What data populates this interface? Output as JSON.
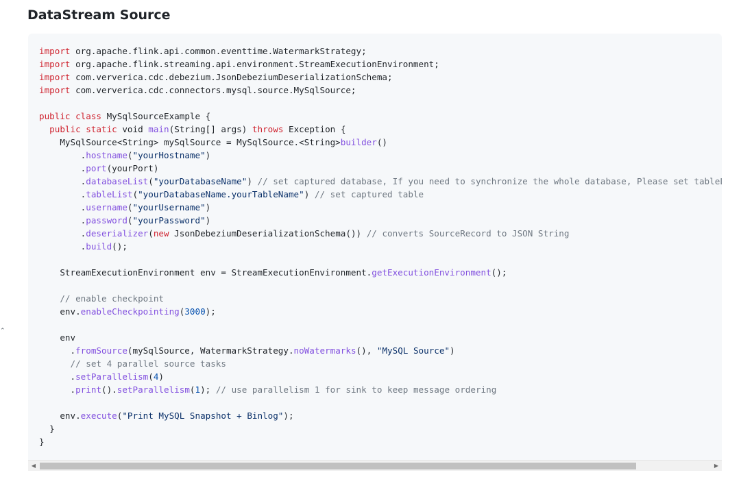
{
  "page": {
    "heading": "DataStream Source"
  },
  "code_block": {
    "language": "java",
    "colors": {
      "background": "#f6f8fa",
      "keyword": "#cf222e",
      "method": "#8250df",
      "string": "#0a3069",
      "number": "#0550ae",
      "comment": "#6e7781"
    },
    "lines": [
      [
        {
          "t": "import",
          "c": "kw"
        },
        {
          "t": " org.apache.flink.api.common.eventtime.WatermarkStrategy;"
        }
      ],
      [
        {
          "t": "import",
          "c": "kw"
        },
        {
          "t": " org.apache.flink.streaming.api.environment.StreamExecutionEnvironment;"
        }
      ],
      [
        {
          "t": "import",
          "c": "kw"
        },
        {
          "t": " com.ververica.cdc.debezium.JsonDebeziumDeserializationSchema;"
        }
      ],
      [
        {
          "t": "import",
          "c": "kw"
        },
        {
          "t": " com.ververica.cdc.connectors.mysql.source.MySqlSource;"
        }
      ],
      [],
      [
        {
          "t": "public",
          "c": "kw"
        },
        {
          "t": " "
        },
        {
          "t": "class",
          "c": "kw"
        },
        {
          "t": " MySqlSourceExample {"
        }
      ],
      [
        {
          "t": "  "
        },
        {
          "t": "public",
          "c": "kw"
        },
        {
          "t": " "
        },
        {
          "t": "static",
          "c": "kw"
        },
        {
          "t": " void "
        },
        {
          "t": "main",
          "c": "fn"
        },
        {
          "t": "(String[] args) "
        },
        {
          "t": "throws",
          "c": "kw"
        },
        {
          "t": " Exception {"
        }
      ],
      [
        {
          "t": "    MySqlSource<String> mySqlSource = MySqlSource.<String>"
        },
        {
          "t": "builder",
          "c": "fn"
        },
        {
          "t": "()"
        }
      ],
      [
        {
          "t": "        ."
        },
        {
          "t": "hostname",
          "c": "fn"
        },
        {
          "t": "("
        },
        {
          "t": "\"yourHostname\"",
          "c": "str"
        },
        {
          "t": ")"
        }
      ],
      [
        {
          "t": "        ."
        },
        {
          "t": "port",
          "c": "fn"
        },
        {
          "t": "(yourPort)"
        }
      ],
      [
        {
          "t": "        ."
        },
        {
          "t": "databaseList",
          "c": "fn"
        },
        {
          "t": "("
        },
        {
          "t": "\"yourDatabaseName\"",
          "c": "str"
        },
        {
          "t": ") "
        },
        {
          "t": "// set captured database, If you need to synchronize the whole database, Please set tableList",
          "c": "cm"
        }
      ],
      [
        {
          "t": "        ."
        },
        {
          "t": "tableList",
          "c": "fn"
        },
        {
          "t": "("
        },
        {
          "t": "\"yourDatabaseName.yourTableName\"",
          "c": "str"
        },
        {
          "t": ") "
        },
        {
          "t": "// set captured table",
          "c": "cm"
        }
      ],
      [
        {
          "t": "        ."
        },
        {
          "t": "username",
          "c": "fn"
        },
        {
          "t": "("
        },
        {
          "t": "\"yourUsername\"",
          "c": "str"
        },
        {
          "t": ")"
        }
      ],
      [
        {
          "t": "        ."
        },
        {
          "t": "password",
          "c": "fn"
        },
        {
          "t": "("
        },
        {
          "t": "\"yourPassword\"",
          "c": "str"
        },
        {
          "t": ")"
        }
      ],
      [
        {
          "t": "        ."
        },
        {
          "t": "deserializer",
          "c": "fn"
        },
        {
          "t": "("
        },
        {
          "t": "new",
          "c": "kw"
        },
        {
          "t": " JsonDebeziumDeserializationSchema()) "
        },
        {
          "t": "// converts SourceRecord to JSON String",
          "c": "cm"
        }
      ],
      [
        {
          "t": "        ."
        },
        {
          "t": "build",
          "c": "fn"
        },
        {
          "t": "();"
        }
      ],
      [],
      [
        {
          "t": "    StreamExecutionEnvironment env = StreamExecutionEnvironment."
        },
        {
          "t": "getExecutionEnvironment",
          "c": "fn"
        },
        {
          "t": "();"
        }
      ],
      [],
      [
        {
          "t": "    "
        },
        {
          "t": "// enable checkpoint",
          "c": "cm"
        }
      ],
      [
        {
          "t": "    env."
        },
        {
          "t": "enableCheckpointing",
          "c": "fn"
        },
        {
          "t": "("
        },
        {
          "t": "3000",
          "c": "num"
        },
        {
          "t": ");"
        }
      ],
      [],
      [
        {
          "t": "    env"
        }
      ],
      [
        {
          "t": "      ."
        },
        {
          "t": "fromSource",
          "c": "fn"
        },
        {
          "t": "(mySqlSource, WatermarkStrategy."
        },
        {
          "t": "noWatermarks",
          "c": "fn"
        },
        {
          "t": "(), "
        },
        {
          "t": "\"MySQL Source\"",
          "c": "str"
        },
        {
          "t": ")"
        }
      ],
      [
        {
          "t": "      "
        },
        {
          "t": "// set 4 parallel source tasks",
          "c": "cm"
        }
      ],
      [
        {
          "t": "      ."
        },
        {
          "t": "setParallelism",
          "c": "fn"
        },
        {
          "t": "("
        },
        {
          "t": "4",
          "c": "num"
        },
        {
          "t": ")"
        }
      ],
      [
        {
          "t": "      ."
        },
        {
          "t": "print",
          "c": "fn"
        },
        {
          "t": "()."
        },
        {
          "t": "setParallelism",
          "c": "fn"
        },
        {
          "t": "("
        },
        {
          "t": "1",
          "c": "num"
        },
        {
          "t": "); "
        },
        {
          "t": "// use parallelism 1 for sink to keep message ordering",
          "c": "cm"
        }
      ],
      [],
      [
        {
          "t": "    env."
        },
        {
          "t": "execute",
          "c": "fn"
        },
        {
          "t": "("
        },
        {
          "t": "\"Print MySQL Snapshot + Binlog\"",
          "c": "str"
        },
        {
          "t": ");"
        }
      ],
      [
        {
          "t": "  }"
        }
      ],
      [
        {
          "t": "}"
        }
      ]
    ]
  },
  "scrollbar": {
    "left_arrow": "◀",
    "right_arrow": "▶",
    "visible_fraction": 0.89,
    "scroll_position": 0.0
  },
  "edge_mark": {
    "text": "⌃"
  }
}
